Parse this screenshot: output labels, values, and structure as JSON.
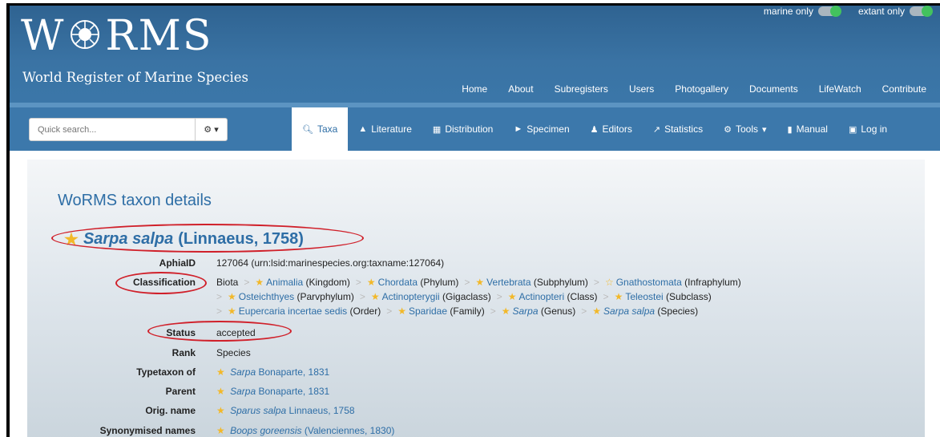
{
  "brand": {
    "title": "WoRMS",
    "subtitle": "World Register of Marine Species"
  },
  "toggles": [
    {
      "label": "marine only",
      "state": "on"
    },
    {
      "label": "extant only",
      "state": "on"
    }
  ],
  "top_nav": [
    "Home",
    "About",
    "Subregisters",
    "Users",
    "Photogallery",
    "Documents",
    "LifeWatch",
    "Contribute"
  ],
  "search": {
    "placeholder": "Quick search...",
    "options_icon": "gear-icon"
  },
  "tabs": [
    {
      "label": "Taxa",
      "icon": "search-icon",
      "active": true
    },
    {
      "label": "Literature",
      "icon": "graduation-cap-icon"
    },
    {
      "label": "Distribution",
      "icon": "map-icon"
    },
    {
      "label": "Specimen",
      "icon": "tag-icon"
    },
    {
      "label": "Editors",
      "icon": "users-icon"
    },
    {
      "label": "Statistics",
      "icon": "chart-icon"
    },
    {
      "label": "Tools",
      "icon": "cogs-icon",
      "dropdown": true
    },
    {
      "label": "Manual",
      "icon": "book-icon"
    },
    {
      "label": "Log in",
      "icon": "lock-icon"
    }
  ],
  "page": {
    "heading": "WoRMS taxon details",
    "taxon_name": "Sarpa salpa",
    "taxon_authority": "(Linnaeus, 1758)"
  },
  "details": {
    "aphia_label": "AphiaID",
    "aphia_value": "127064  (urn:lsid:marinespecies.org:taxname:127064)",
    "classification_label": "Classification",
    "classification": [
      {
        "name": "Biota",
        "rank": "",
        "star": "none",
        "link": false
      },
      {
        "name": "Animalia",
        "rank": "(Kingdom)",
        "star": "full"
      },
      {
        "name": "Chordata",
        "rank": "(Phylum)",
        "star": "full"
      },
      {
        "name": "Vertebrata",
        "rank": "(Subphylum)",
        "star": "full"
      },
      {
        "name": "Gnathostomata",
        "rank": "(Infraphylum)",
        "star": "outline"
      },
      {
        "name": "Osteichthyes",
        "rank": "(Parvphylum)",
        "star": "full"
      },
      {
        "name": "Actinopterygii",
        "rank": "(Gigaclass)",
        "star": "full"
      },
      {
        "name": "Actinopteri",
        "rank": "(Class)",
        "star": "full"
      },
      {
        "name": "Teleostei",
        "rank": "(Subclass)",
        "star": "full"
      },
      {
        "name": "Eupercaria incertae sedis",
        "rank": "(Order)",
        "star": "full"
      },
      {
        "name": "Sparidae",
        "rank": "(Family)",
        "star": "full"
      },
      {
        "name": "Sarpa",
        "rank": "(Genus)",
        "star": "full",
        "italic": true
      },
      {
        "name": "Sarpa salpa",
        "rank": "(Species)",
        "star": "full",
        "italic": true
      }
    ],
    "status_label": "Status",
    "status_value": "accepted",
    "rank_label": "Rank",
    "rank_value": "Species",
    "typetaxon_label": "Typetaxon of",
    "typetaxon_genus": "Sarpa",
    "typetaxon_author": "Bonaparte, 1831",
    "parent_label": "Parent",
    "parent_genus": "Sarpa",
    "parent_author": "Bonaparte, 1831",
    "orig_label": "Orig. name",
    "orig_name": "Sparus salpa",
    "orig_author": "Linnaeus, 1758",
    "syn_label": "Synonymised names",
    "syn_name": "Boops goreensis",
    "syn_author": "(Valenciennes, 1830)"
  },
  "colors": {
    "header": "#3a73a4",
    "link": "#2e6ea6",
    "star": "#f2b829",
    "annotation_ellipse": "#d0202a"
  }
}
